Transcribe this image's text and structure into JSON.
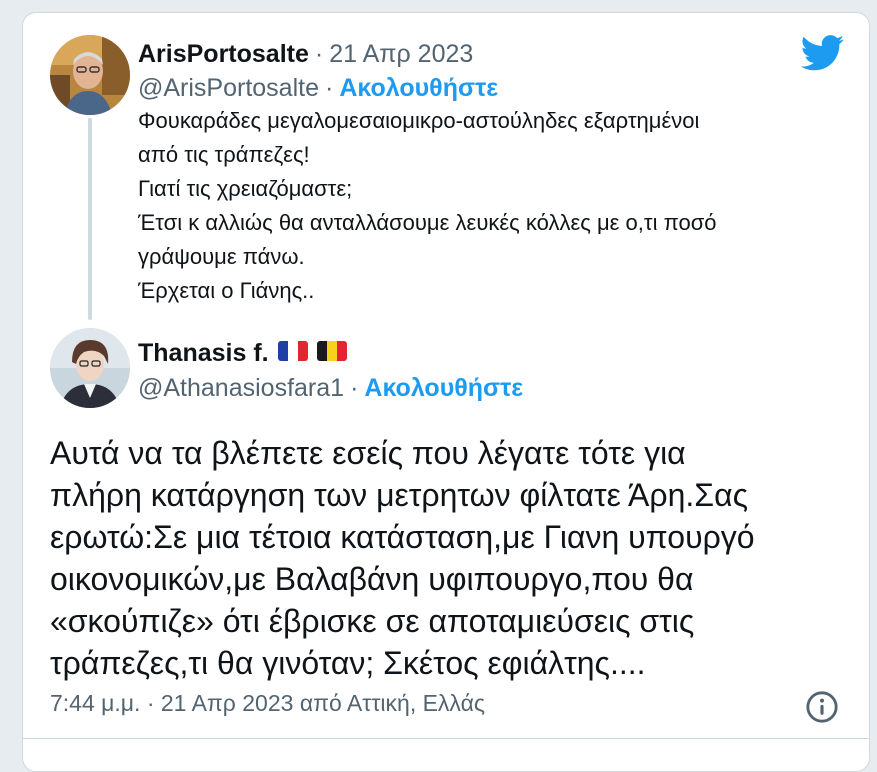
{
  "quoted_tweet": {
    "display_name": "ArisPortosalte",
    "separator": "·",
    "date": "21 Απρ 2023",
    "handle": "@ArisPortosalte",
    "follow_label": "Ακολουθήστε",
    "lines": [
      "Φουκαράδες μεγαλομεσαιομικρο-αστούληδες εξαρτημένοι",
      "από τις τράπεζες!",
      "Γιατί τις χρειαζόμαστε;",
      "Έτσι κ αλλιώς θα ανταλλάσουμε λευκές κόλλες με ο,τι ποσό",
      "γράψουμε πάνω.",
      "Έρχεται ο Γιάνης.."
    ]
  },
  "main_tweet": {
    "display_name": "Thanasis f.",
    "flags": [
      "flag-france-icon",
      "flag-belgium-icon"
    ],
    "handle": "@Athanasiosfara1",
    "separator": "·",
    "follow_label": "Ακολουθήστε",
    "lines": [
      "Αυτά να τα βλέπετε εσείς που λέγατε τότε για",
      "πλήρη κατάργηση των μετρητων φίλτατε Άρη.Σας",
      "ερωτώ:Σε μια τέτοια κατάσταση,με Γιανη υπουργό",
      "οικονομικών,με Βαλαβάνη υφιπουργο,που θα",
      "«σκούπιζε» ότι έβρισκε σε αποταμιεύσεις στις",
      "τράπεζες,τι θα γινόταν; Σκέτος εφιάλτης...."
    ],
    "footer": "7:44 μ.μ. · 21 Απρ 2023 από Αττική, Ελλάς"
  },
  "icons": {
    "brand": "twitter-bird-icon",
    "info": "info-icon"
  },
  "colors": {
    "accent": "#1d9bf0",
    "secondary_text": "#536471",
    "primary_text": "#0f1419",
    "divider": "#cfd9de"
  }
}
